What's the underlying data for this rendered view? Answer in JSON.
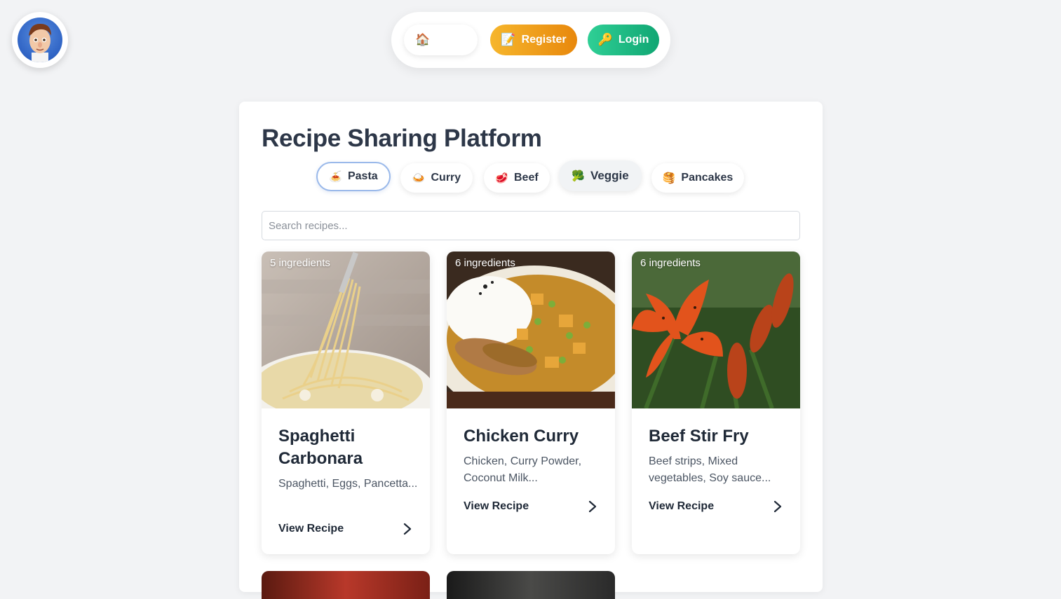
{
  "nav": {
    "home_icon": "🏠",
    "register_icon": "📝",
    "register_label": "Register",
    "login_icon": "🔑",
    "login_label": "Login"
  },
  "avatar": {
    "icon": "chef-avatar"
  },
  "page": {
    "title": "Recipe Sharing Platform"
  },
  "categories": [
    {
      "icon": "🍝",
      "label": "Pasta",
      "active": true
    },
    {
      "icon": "🍛",
      "label": "Curry"
    },
    {
      "icon": "🥩",
      "label": "Beef"
    },
    {
      "icon": "🥦",
      "label": "Veggie"
    },
    {
      "icon": "🥞",
      "label": "Pancakes"
    }
  ],
  "search": {
    "placeholder": "Search recipes..."
  },
  "recipes": [
    {
      "badge": "5 ingredients",
      "title": "Spaghetti Carbonara",
      "ingredients": "Spaghetti, Eggs, Pancetta...",
      "action": "View Recipe"
    },
    {
      "badge": "6 ingredients",
      "title": "Chicken Curry",
      "ingredients": "Chicken, Curry Powder, Coconut Milk...",
      "action": "View Recipe"
    },
    {
      "badge": "6 ingredients",
      "title": "Beef Stir Fry",
      "ingredients": "Beef strips, Mixed vegetables, Soy sauce...",
      "action": "View Recipe"
    }
  ],
  "colors": {
    "register": "#f0a41e",
    "login": "#1db884",
    "active_chip_border": "#9ab9ea"
  }
}
